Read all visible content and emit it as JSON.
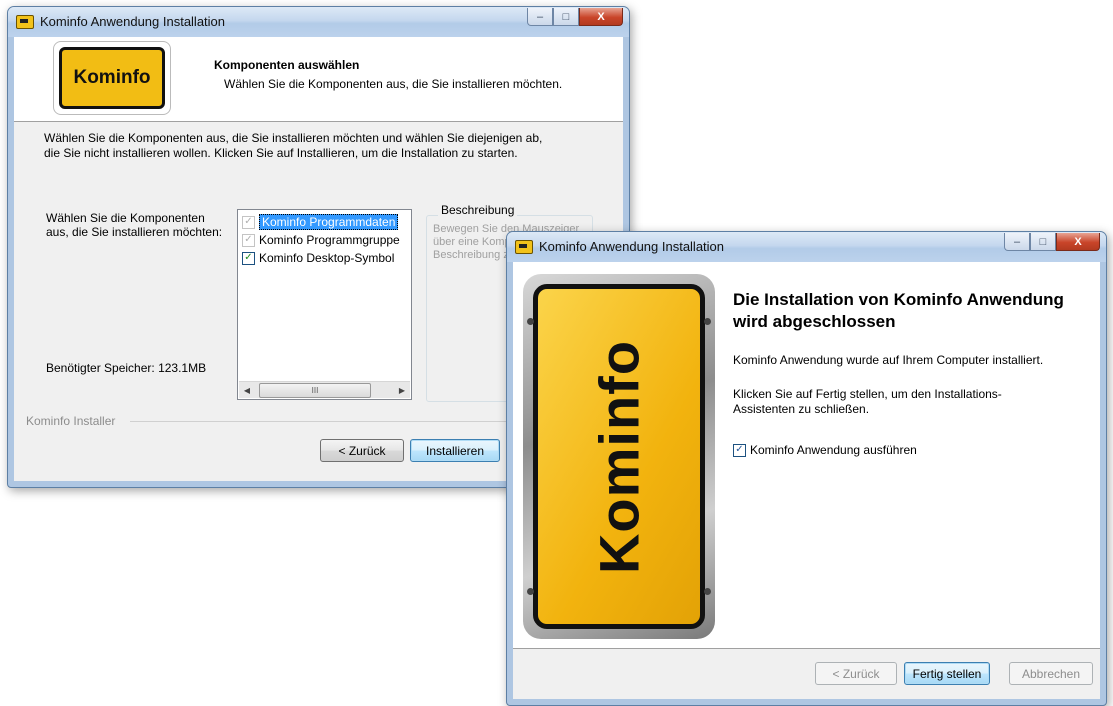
{
  "window1": {
    "title": "Kominfo Anwendung Installation",
    "logo_text": "Kominfo",
    "header_title": "Komponenten auswählen",
    "header_subtitle": "Wählen Sie die Komponenten aus, die Sie installieren möchten.",
    "intro_line1": "Wählen Sie die Komponenten aus, die Sie installieren möchten und wählen Sie diejenigen ab,",
    "intro_line2": "die Sie nicht installieren wollen. Klicken Sie auf Installieren, um die Installation zu starten.",
    "components_label": "Wählen Sie die Komponenten aus, die Sie installieren möchten:",
    "components": [
      {
        "label": "Kominfo Programmdaten",
        "checked": true,
        "disabled": true,
        "selected": true
      },
      {
        "label": "Kominfo Programmgruppe",
        "checked": true,
        "disabled": true,
        "selected": false
      },
      {
        "label": "Kominfo Desktop-Symbol",
        "checked": true,
        "disabled": false,
        "selected": false
      }
    ],
    "scroll_thumb": "III",
    "description_title": "Beschreibung",
    "description_text": "Bewegen Sie den Mauszeiger über eine Komponente, um ihre Beschreibung zu sehen.",
    "space_required": "Benötigter Speicher: 123.1MB",
    "installer_label": "Kominfo Installer",
    "back_button": "< Zurück",
    "install_button": "Installieren"
  },
  "window2": {
    "title": "Kominfo Anwendung Installation",
    "sign_text": "Kominfo",
    "finish_title": "Die Installation von Kominfo Anwendung wird abgeschlossen",
    "message1": "Kominfo Anwendung wurde auf Ihrem Computer installiert.",
    "message2": "Klicken Sie auf Fertig stellen, um den Installations-Assistenten zu schließen.",
    "run_checkbox_label": "Kominfo Anwendung ausführen",
    "run_checked": true,
    "back_button": "< Zurück",
    "finish_button": "Fertig stellen",
    "cancel_button": "Abbrechen"
  },
  "colors": {
    "sign_yellow": "#f2bd14",
    "selection_blue": "#3399ff",
    "window_frame": "#aec6e2"
  }
}
